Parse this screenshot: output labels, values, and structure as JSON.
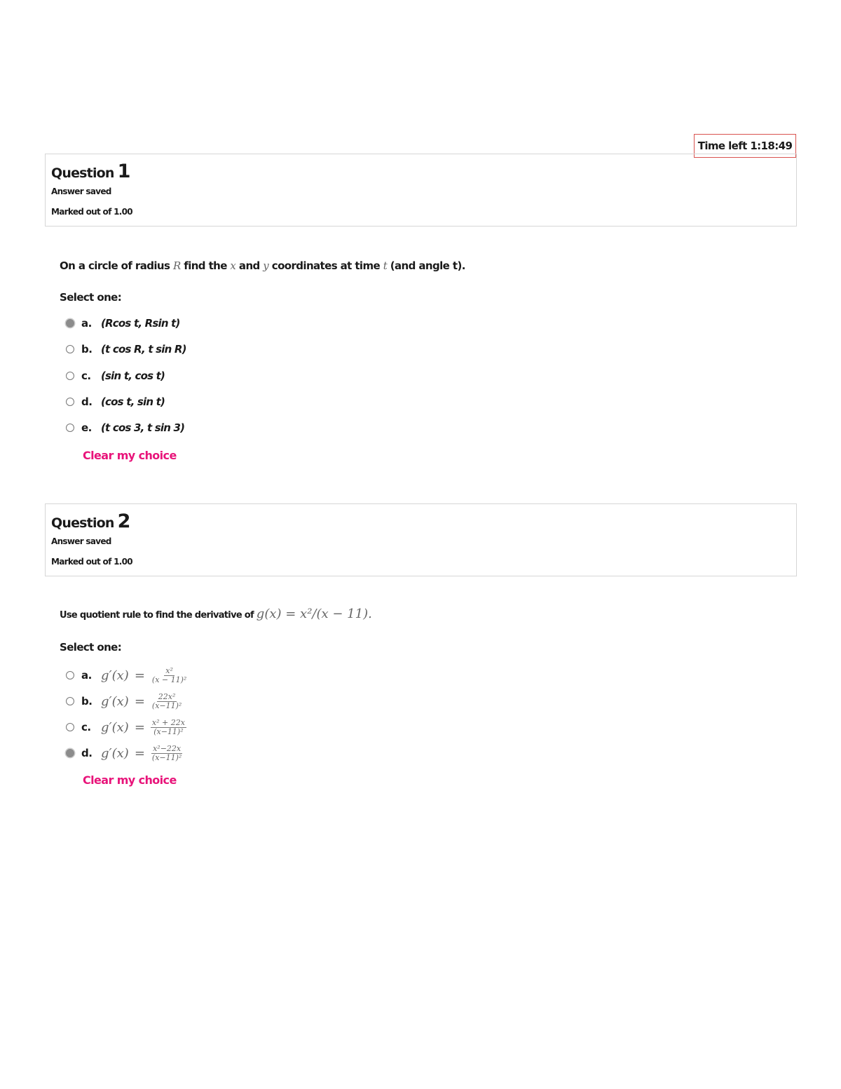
{
  "timer": {
    "label": "Time left 1:18:49"
  },
  "questions": [
    {
      "title_word": "Question",
      "number": "1",
      "state": "Answer saved",
      "grade": "Marked out of 1.00",
      "text": {
        "part1": "On a circle of radius ",
        "R": "R",
        "part2": " find the ",
        "x": "x",
        "part3": " and ",
        "y": "y",
        "part4": " coordinates at time ",
        "t": "t",
        "part5": " (and angle t)."
      },
      "prompt": "Select one:",
      "options": [
        {
          "letter": "a.",
          "text": "(Rcos t, Rsin t)",
          "checked": true
        },
        {
          "letter": "b.",
          "text": "(t cos R, t sin R)",
          "checked": false
        },
        {
          "letter": "c.",
          "text": "(sin t, cos t)",
          "checked": false
        },
        {
          "letter": "d.",
          "text": "(cos t, sin t)",
          "checked": false
        },
        {
          "letter": "e.",
          "text": "(t cos 3, t sin 3)",
          "checked": false
        }
      ],
      "clear": "Clear my choice"
    },
    {
      "title_word": "Question",
      "number": "2",
      "state": "Answer saved",
      "grade": "Marked out of 1.00",
      "text": {
        "part1": "Use quotient rule to find the derivative of ",
        "formula": "g(x) = x²/(x − 11)."
      },
      "prompt": "Select one:",
      "options": [
        {
          "letter": "a.",
          "lhs": "g′(x)",
          "eq": "=",
          "num": "x²",
          "den": "(x − 11)²",
          "checked": false
        },
        {
          "letter": "b.",
          "lhs": "g′(x)",
          "eq": "=",
          "num": "22x²",
          "den": "(x−11)²",
          "checked": false
        },
        {
          "letter": "c.",
          "lhs": "g′(x)",
          "eq": "=",
          "num": "x² + 22x",
          "den": "(x−11)²",
          "checked": false
        },
        {
          "letter": "d.",
          "lhs": "g′(x)",
          "eq": "=",
          "num": "x²−22x",
          "den": "(x−11)²",
          "checked": true
        }
      ],
      "clear": "Clear my choice"
    }
  ],
  "colors": {
    "accent": "#e8147a",
    "timer_border": "#d9534f",
    "panel_border": "#d6d6d6"
  },
  "icons": {
    "radio_checked": "radio-checked-icon",
    "radio_unchecked": "radio-unchecked-icon"
  }
}
